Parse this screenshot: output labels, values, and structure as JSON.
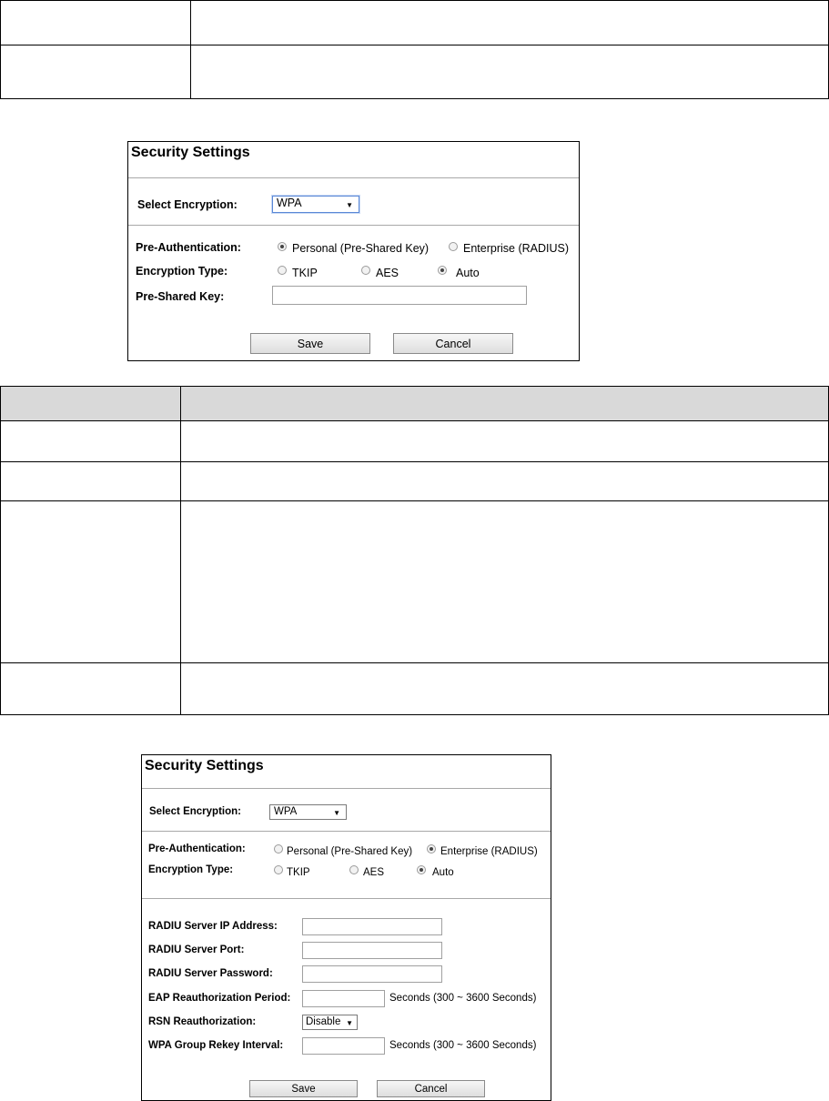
{
  "panel1": {
    "title": "Security Settings",
    "select_encryption_label": "Select Encryption:",
    "select_encryption_value": "WPA",
    "pre_auth_label": "Pre-Authentication:",
    "pre_auth_options": [
      "Personal (Pre-Shared Key)",
      "Enterprise (RADIUS)"
    ],
    "pre_auth_selected": "Personal (Pre-Shared Key)",
    "encryption_type_label": "Encryption Type:",
    "encryption_type_options": [
      "TKIP",
      "AES",
      "Auto"
    ],
    "encryption_type_selected": "Auto",
    "psk_label": "Pre-Shared Key:",
    "psk_value": "",
    "save_label": "Save",
    "cancel_label": "Cancel"
  },
  "panel2": {
    "title": "Security Settings",
    "select_encryption_label": "Select Encryption:",
    "select_encryption_value": "WPA",
    "pre_auth_label": "Pre-Authentication:",
    "pre_auth_options": [
      "Personal (Pre-Shared Key)",
      "Enterprise (RADIUS)"
    ],
    "pre_auth_selected": "Enterprise (RADIUS)",
    "encryption_type_label": "Encryption Type:",
    "encryption_type_options": [
      "TKIP",
      "AES",
      "Auto"
    ],
    "encryption_type_selected": "Auto",
    "radius_ip_label": "RADIU Server IP Address:",
    "radius_port_label": "RADIU Server Port:",
    "radius_password_label": "RADIU Server Password:",
    "eap_label": "EAP Reauthorization Period:",
    "eap_suffix": "Seconds  (300 ~ 3600 Seconds)",
    "rsn_label": "RSN Reauthorization:",
    "rsn_value": "Disable",
    "rekey_label": "WPA Group Rekey Interval:",
    "rekey_suffix": "Seconds  (300 ~ 3600 Seconds)",
    "save_label": "Save",
    "cancel_label": "Cancel"
  },
  "tables": {
    "top_table_rows": 2,
    "middle_table_rows": 5
  }
}
